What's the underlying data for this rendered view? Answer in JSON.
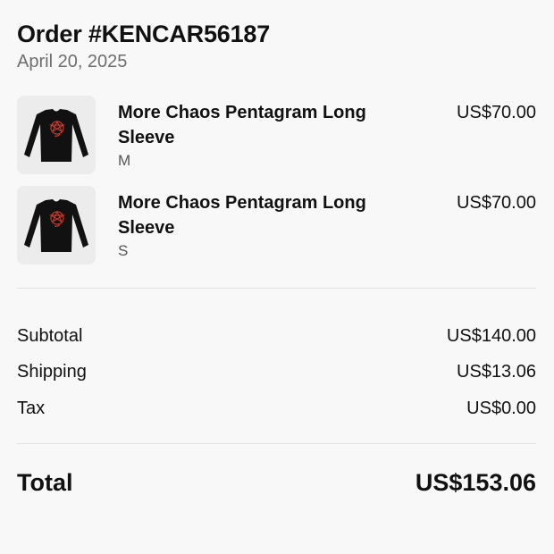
{
  "order": {
    "title": "Order #KENCAR56187",
    "date": "April 20, 2025"
  },
  "items": [
    {
      "name": "More Chaos Pentagram Long Sleeve",
      "variant": "M",
      "price": "US$70.00",
      "image_icon": "black-longsleeve-shirt-icon"
    },
    {
      "name": "More Chaos Pentagram Long Sleeve",
      "variant": "S",
      "price": "US$70.00",
      "image_icon": "black-longsleeve-shirt-icon"
    }
  ],
  "summary": {
    "subtotal_label": "Subtotal",
    "subtotal_value": "US$140.00",
    "shipping_label": "Shipping",
    "shipping_value": "US$13.06",
    "tax_label": "Tax",
    "tax_value": "US$0.00",
    "total_label": "Total",
    "total_value": "US$153.06"
  },
  "colors": {
    "background": "#f8f8f8",
    "thumb_background": "#ececec",
    "text": "#111111",
    "muted": "#6e6e6e",
    "shirt": "#111111",
    "print": "#c0392b"
  }
}
